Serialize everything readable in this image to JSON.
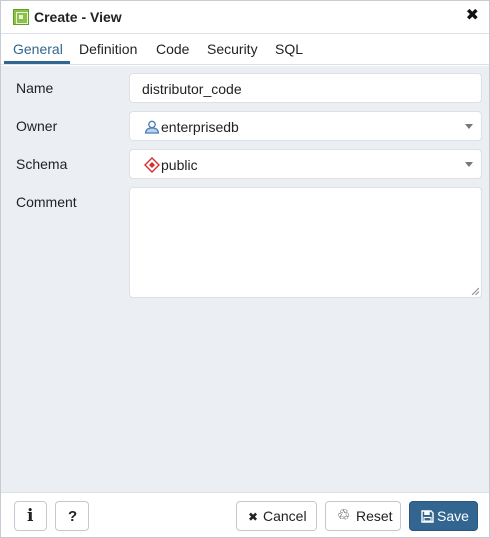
{
  "dialog": {
    "title": "Create - View",
    "title_icon": "view-icon",
    "close_icon": "close-icon",
    "close_glyph": "✖"
  },
  "tabs": [
    {
      "label": "General",
      "active": true
    },
    {
      "label": "Definition",
      "active": false
    },
    {
      "label": "Code",
      "active": false
    },
    {
      "label": "Security",
      "active": false
    },
    {
      "label": "SQL",
      "active": false
    }
  ],
  "form": {
    "name": {
      "label": "Name",
      "value": "distributor_code"
    },
    "owner": {
      "label": "Owner",
      "value": "enterprisedb",
      "icon": "user-icon"
    },
    "schema": {
      "label": "Schema",
      "value": "public",
      "icon": "schema-icon"
    },
    "comment": {
      "label": "Comment",
      "value": ""
    }
  },
  "footer": {
    "info_glyph": "i",
    "help_glyph": "?",
    "cancel_label": "Cancel",
    "cancel_glyph": "✖",
    "reset_label": "Reset",
    "reset_glyph": "♲",
    "save_label": "Save",
    "save_icon": "floppy-icon"
  },
  "colors": {
    "accent": "#326690",
    "content_bg": "#ebeef3",
    "view_icon": "#8bc34a",
    "schema_icon": "#d32f2f"
  }
}
